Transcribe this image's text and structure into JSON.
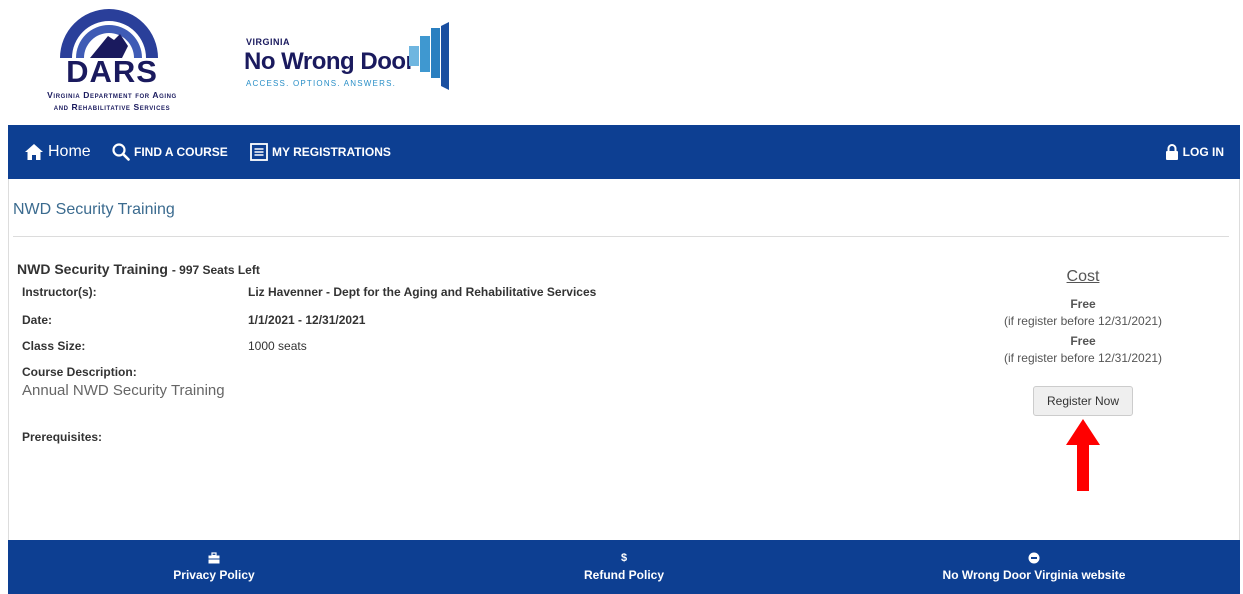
{
  "header": {
    "dars": {
      "wordmark": "DARS",
      "line1": "Virginia Department for Aging",
      "line2": "and Rehabilitative Services"
    },
    "nwd": {
      "state": "VIRGINIA",
      "name": "No Wrong Door",
      "tagline": "ACCESS. OPTIONS. ANSWERS."
    }
  },
  "nav": {
    "home": "Home",
    "find_course": "FIND A COURSE",
    "my_registrations": "MY REGISTRATIONS",
    "login": "LOG IN"
  },
  "page": {
    "title": "NWD Security Training"
  },
  "course": {
    "name": "NWD Security Training",
    "seats_left": "- 997 Seats Left",
    "instructor_label": "Instructor(s):",
    "instructor_value": "Liz Havenner - Dept for the Aging and Rehabilitative Services",
    "date_label": "Date:",
    "date_value": "1/1/2021 - 12/31/2021",
    "class_size_label": "Class Size:",
    "class_size_value": "1000 seats",
    "description_label": "Course Description:",
    "description_value": "Annual NWD Security Training",
    "prerequisites_label": "Prerequisites:"
  },
  "cost": {
    "title": "Cost",
    "tiers": [
      {
        "price": "Free",
        "note": "(if register before 12/31/2021)"
      },
      {
        "price": "Free",
        "note": "(if register before 12/31/2021)"
      }
    ],
    "register_label": "Register Now"
  },
  "footer": {
    "privacy": "Privacy Policy",
    "refund_icon": "$",
    "refund": "Refund Policy",
    "nwd_site": "No Wrong Door Virginia website"
  },
  "colors": {
    "nav_blue": "#0d3f92",
    "title_blue": "#3b6b8f",
    "arrow_red": "#ff0000"
  }
}
